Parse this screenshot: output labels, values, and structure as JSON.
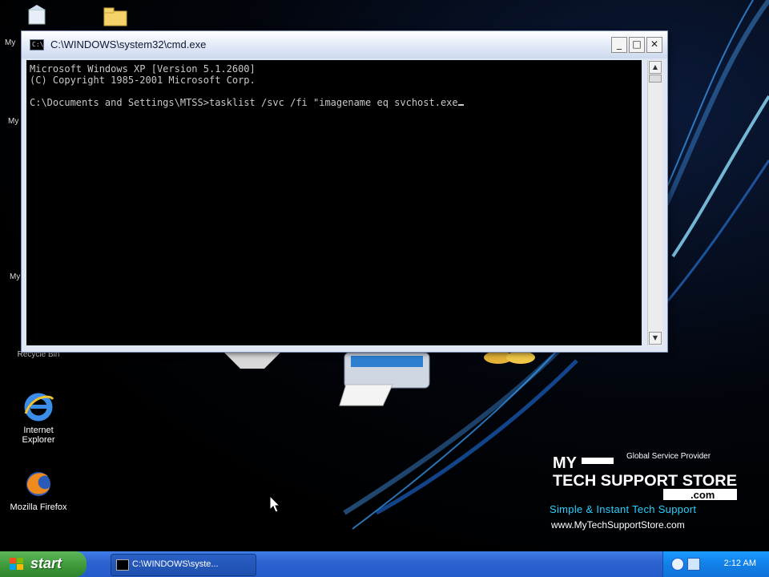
{
  "desktop": {
    "icons": [
      {
        "label": "Recycle Bin",
        "icon": "recycle-bin-icon"
      },
      {
        "label": "Internet\nExplorer",
        "icon": "internet-explorer-icon"
      },
      {
        "label": "Mozilla Firefox",
        "icon": "firefox-icon"
      }
    ],
    "partial_labels": [
      "My",
      "My",
      "My"
    ]
  },
  "cmd_window": {
    "title": "C:\\WINDOWS\\system32\\cmd.exe",
    "icon": "console-icon",
    "buttons": {
      "minimize": "_",
      "maximize": "□",
      "close": "✕"
    },
    "lines": [
      "Microsoft Windows XP [Version 5.1.2600]",
      "(C) Copyright 1985-2001 Microsoft Corp.",
      "",
      "C:\\Documents and Settings\\MTSS>tasklist /svc /fi \"imagename eq svchost.exe"
    ]
  },
  "branding": {
    "tagline": "Global Service Provider",
    "logo_line1": "MY",
    "logo_line2": "TECH SUPPORT STORE",
    "logo_com": ".com",
    "slogan": "Simple & Instant Tech Support",
    "url": "www.MyTechSupportStore.com"
  },
  "taskbar": {
    "start_label": "start",
    "active_task": "C:\\WINDOWS\\syste...",
    "clock": "2:12 AM",
    "colors": {
      "start": "#3e9a3b",
      "bar": "#245bcc",
      "tray": "#1280e8"
    }
  }
}
